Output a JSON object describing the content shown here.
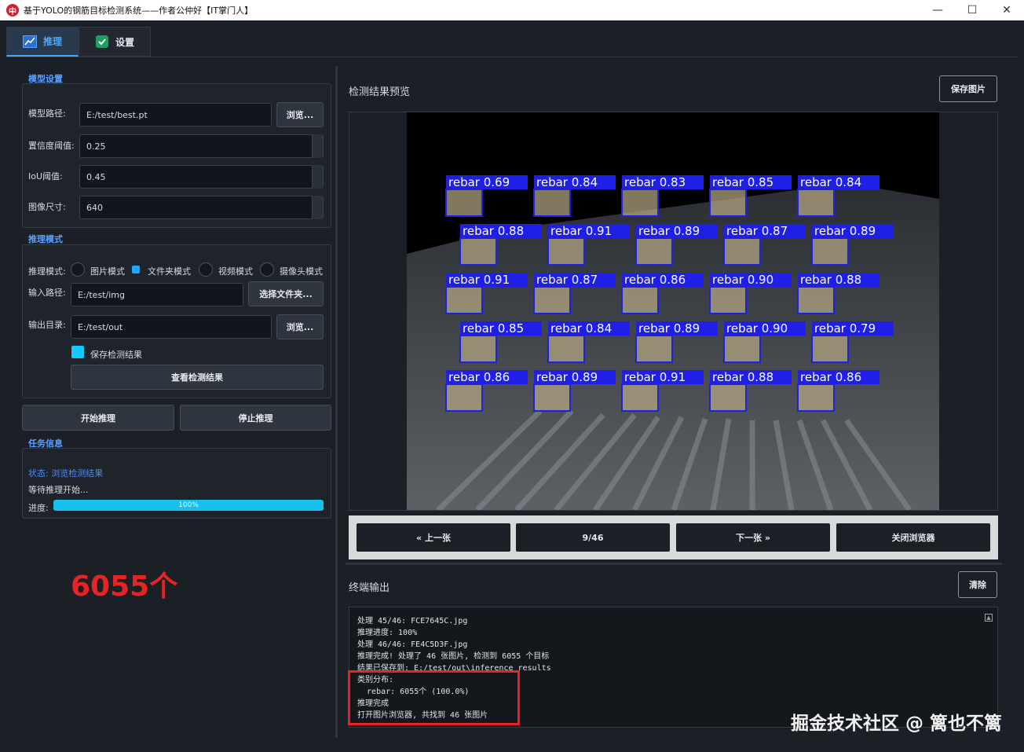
{
  "window": {
    "title": "基于YOLO的钢筋目标检测系统——作者公仲好【IT掌门人】",
    "controls": {
      "minimize": "—",
      "maximize": "☐",
      "close": "✕"
    }
  },
  "tabs": [
    {
      "label": "推理",
      "icon": "chart-icon"
    },
    {
      "label": "设置",
      "icon": "check-icon"
    }
  ],
  "model_settings": {
    "title": "模型设置",
    "model_path_label": "模型路径:",
    "model_path_value": "E:/test/best.pt",
    "browse_label": "浏览...",
    "conf_label": "置信度阈值:",
    "conf_value": "0.25",
    "iou_label": "IoU阈值:",
    "iou_value": "0.45",
    "imgsz_label": "图像尺寸:",
    "imgsz_value": "640"
  },
  "inference_mode": {
    "title": "推理模式",
    "mode_label": "推理模式:",
    "options": [
      "图片模式",
      "文件夹模式",
      "视频模式",
      "摄像头模式"
    ],
    "selected": "文件夹模式",
    "input_label": "输入路径:",
    "input_value": "E:/test/img",
    "select_folder_label": "选择文件夹...",
    "output_label": "输出目录:",
    "output_value": "E:/test/out",
    "browse_label": "浏览...",
    "save_results_label": "保存检测结果",
    "view_results_label": "查看检测结果"
  },
  "actions": {
    "start": "开始推理",
    "stop": "停止推理"
  },
  "task_info": {
    "title": "任务信息",
    "status": "状态: 浏览检测结果",
    "waiting": "等待推理开始...",
    "progress_label": "进度:",
    "progress_value": 100,
    "progress_text": "100%"
  },
  "annotation": {
    "count_text": "6055个",
    "color": "#e82323"
  },
  "preview": {
    "title": "检测结果预览",
    "save_image_label": "保存图片",
    "detections": [
      "rebar 0.69",
      "rebar 0.84",
      "rebar 0.83",
      "rebar 0.85",
      "rebar 0.84",
      "rebar 0.88",
      "rebar 0.91",
      "rebar 0.89",
      "rebar 0.87",
      "rebar 0.89",
      "rebar 0.91",
      "rebar 0.87",
      "rebar 0.86",
      "rebar 0.90",
      "rebar 0.88",
      "rebar 0.85",
      "rebar 0.84",
      "rebar 0.89",
      "rebar 0.90",
      "rebar 0.79",
      "rebar 0.86",
      "rebar 0.89",
      "rebar 0.91",
      "rebar 0.88",
      "rebar 0.86"
    ]
  },
  "nav": {
    "prev": "« 上一张",
    "page": "9/46",
    "next": "下一张 »",
    "close": "关闭浏览器"
  },
  "terminal": {
    "title": "终端输出",
    "clear_label": "清除",
    "lines": [
      "处理 45/46: FCE7645C.jpg",
      "推理进度: 100%",
      "处理 46/46: FE4C5D3F.jpg",
      "推理完成! 处理了 46 张图片, 检测到 6055 个目标",
      "结果已保存到: E:/test/out\\inference_results",
      "类别分布:",
      "  rebar: 6055个 (100.0%)",
      "推理完成",
      "打开图片浏览器, 共找到 46 张图片"
    ]
  },
  "watermark": "掘金技术社区 @ 篱也不篱"
}
